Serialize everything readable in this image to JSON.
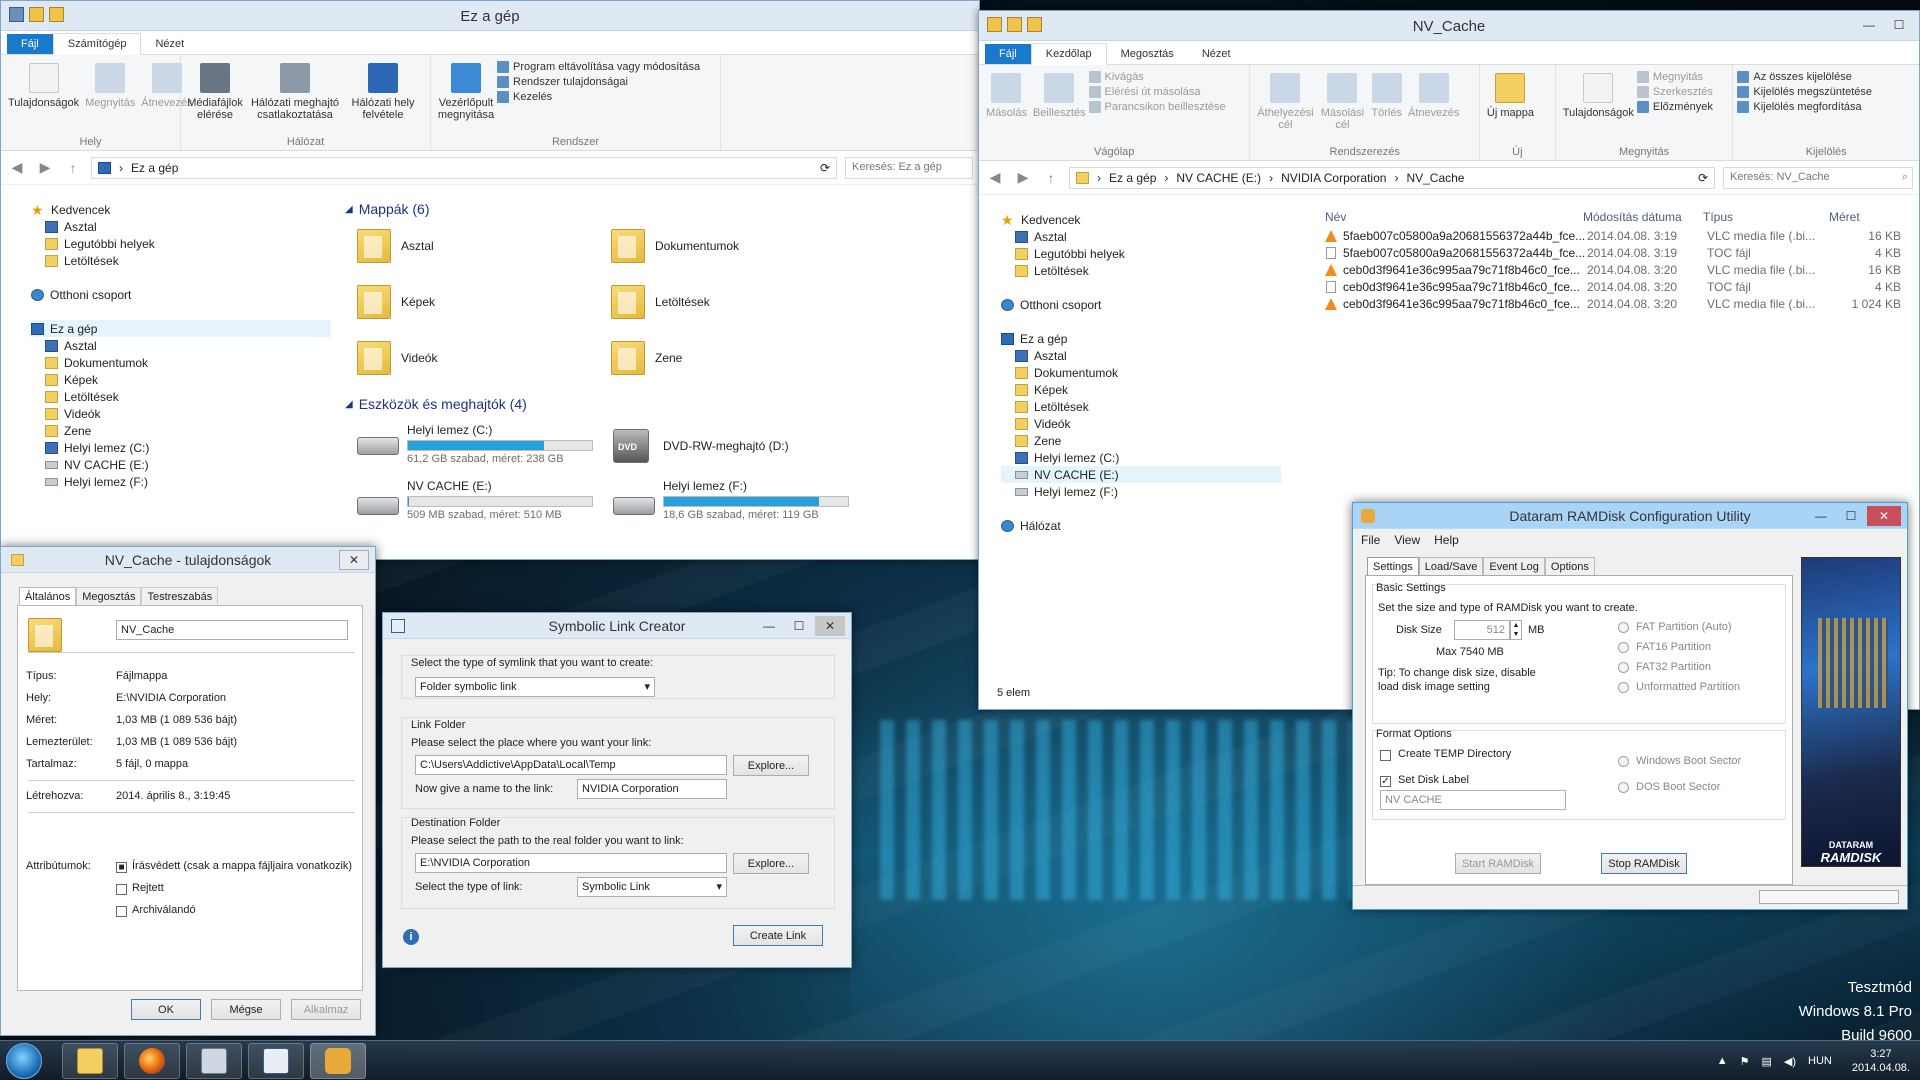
{
  "explorer1": {
    "title": "Ez a gép",
    "tabs": [
      "Fájl",
      "Számítógép",
      "Nézet"
    ],
    "ribbon": {
      "hely_group": "Hely",
      "halozat_group": "Hálózat",
      "rendszer_group": "Rendszer",
      "btn_tulajdonsagok": "Tulajdonságok",
      "btn_megnyitas": "Megnyitás",
      "btn_atnevezes": "Átnevezés",
      "btn_media": "Médiafájlok elérése",
      "btn_halozati_meghajto": "Hálózati meghajtó csatlakoztatása",
      "btn_halozati_hely": "Hálózati hely felvétele",
      "btn_vezerlopult": "Vezérlőpult megnyitása",
      "small_program": "Program eltávolítása vagy módosítása",
      "small_rendszer": "Rendszer tulajdonságai",
      "small_kezeles": "Kezelés"
    },
    "address": [
      "Ez a gép"
    ],
    "search_placeholder": "Keresés: Ez a gép",
    "nav": {
      "kedvencek": "Kedvencek",
      "asztal": "Asztal",
      "legutobbi": "Legutóbbi helyek",
      "letoltesek": "Letöltések",
      "otthoni": "Otthoni csoport",
      "ezagep": "Ez a gép",
      "asztal2": "Asztal",
      "dokumentumok": "Dokumentumok",
      "kepek": "Képek",
      "letoltesek2": "Letöltések",
      "videok": "Videók",
      "zene": "Zene",
      "helyi_c": "Helyi lemez (C:)",
      "nv_e": "NV CACHE (E:)",
      "helyi_f": "Helyi lemez (F:)"
    },
    "folders_header": "Mappák (6)",
    "folders": [
      "Asztal",
      "Dokumentumok",
      "Képek",
      "Letöltések",
      "Videók",
      "Zene"
    ],
    "drives_header": "Eszközök és meghajtók (4)",
    "drives": {
      "c": {
        "name": "Helyi lemez (C:)",
        "meta": "61,2 GB szabad, méret: 238 GB",
        "used_fraction": 0.74
      },
      "d": {
        "name": "DVD-RW-meghajtó (D:)"
      },
      "e": {
        "name": "NV CACHE (E:)",
        "meta": "509 MB szabad, méret: 510 MB",
        "used_fraction": 0.002
      },
      "f": {
        "name": "Helyi lemez (F:)",
        "meta": "18,6 GB szabad, méret: 119 GB",
        "used_fraction": 0.84
      }
    },
    "dvd_label": "DVD"
  },
  "explorer2": {
    "title": "NV_Cache",
    "tabs": [
      "Fájl",
      "Kezdőlap",
      "Megosztás",
      "Nézet"
    ],
    "ribbon": {
      "btn_masolas": "Másolás",
      "btn_beillesztes": "Beillesztés",
      "small_kivagas": "Kivágás",
      "small_eleresi": "Elérési út másolása",
      "small_parancsikon": "Parancsikon beillesztése",
      "vagolap_group": "Vágólap",
      "btn_athelyezes": "Áthelyezési cél",
      "btn_masolasi": "Másolási cél",
      "btn_torles": "Törlés",
      "btn_atnevezes": "Átnevezés",
      "rendszerezes_group": "Rendszerezés",
      "btn_uj_mappa": "Új mappa",
      "uj_group": "Új",
      "btn_tulajdonsagok": "Tulajdonságok",
      "small_megnyitas": "Megnyitás",
      "small_szerkesztes": "Szerkesztés",
      "small_elozmenyek": "Előzmények",
      "megnyitas_group": "Megnyitás",
      "small_osszes": "Az összes kijelölése",
      "small_megszuntetese": "Kijelölés megszüntetése",
      "small_megforditasa": "Kijelölés megfordítása",
      "kijeloles_group": "Kijelölés"
    },
    "address": [
      "Ez a gép",
      "NV CACHE (E:)",
      "NVIDIA Corporation",
      "NV_Cache"
    ],
    "search_placeholder": "Keresés: NV_Cache",
    "nav": {
      "kedvencek": "Kedvencek",
      "asztal": "Asztal",
      "legutobbi": "Legutóbbi helyek",
      "letoltesek": "Letöltések",
      "otthoni": "Otthoni csoport",
      "ezagep": "Ez a gép",
      "asztal2": "Asztal",
      "dokumentumok": "Dokumentumok",
      "kepek": "Képek",
      "letoltesek2": "Letöltések",
      "videok": "Videók",
      "zene": "Zene",
      "helyi_c": "Helyi lemez (C:)",
      "nv_e": "NV CACHE (E:)",
      "helyi_f": "Helyi lemez (F:)",
      "halozat": "Hálózat"
    },
    "columns": {
      "nev": "Név",
      "modositas": "Módosítás dátuma",
      "tipus": "Típus",
      "meret": "Méret"
    },
    "files": [
      {
        "name": "5faeb007c05800a9a20681556372a44b_fce...",
        "date": "2014.04.08. 3:19",
        "type": "VLC media file (.bi...",
        "size": "16 KB",
        "icon": "vlc"
      },
      {
        "name": "5faeb007c05800a9a20681556372a44b_fce...",
        "date": "2014.04.08. 3:19",
        "type": "TOC fájl",
        "size": "4 KB",
        "icon": "file"
      },
      {
        "name": "ceb0d3f9641e36c995aa79c71f8b46c0_fce...",
        "date": "2014.04.08. 3:20",
        "type": "VLC media file (.bi...",
        "size": "16 KB",
        "icon": "vlc"
      },
      {
        "name": "ceb0d3f9641e36c995aa79c71f8b46c0_fce...",
        "date": "2014.04.08. 3:20",
        "type": "TOC fájl",
        "size": "4 KB",
        "icon": "file"
      },
      {
        "name": "ceb0d3f9641e36c995aa79c71f8b46c0_fce...",
        "date": "2014.04.08. 3:20",
        "type": "VLC media file (.bi...",
        "size": "1 024 KB",
        "icon": "vlc"
      }
    ],
    "status": "5 elem"
  },
  "props": {
    "title": "NV_Cache - tulajdonságok",
    "tabs": [
      "Általános",
      "Megosztás",
      "Testreszabás"
    ],
    "name_value": "NV_Cache",
    "rows": [
      {
        "label": "Típus:",
        "value": "Fájlmappa"
      },
      {
        "label": "Hely:",
        "value": "E:\\NVIDIA Corporation"
      },
      {
        "label": "Méret:",
        "value": "1,03 MB (1 089 536 bájt)"
      },
      {
        "label": "Lemezterület:",
        "value": "1,03 MB (1 089 536 bájt)"
      },
      {
        "label": "Tartalmaz:",
        "value": "5 fájl, 0 mappa"
      },
      {
        "label": "Létrehozva:",
        "value": "2014. április 8., 3:19:45"
      }
    ],
    "attr_label": "Attribútumok:",
    "attr_readonly": "Írásvédett (csak a mappa fájljaira vonatkozik)",
    "attr_hidden": "Rejtett",
    "attr_archive": "Archiválandó",
    "btn_ok": "OK",
    "btn_cancel": "Mégse",
    "btn_apply": "Alkalmaz"
  },
  "symlink": {
    "title": "Symbolic Link Creator",
    "type_prompt": "Select the type of symlink that you want to create:",
    "type_value": "Folder symbolic link",
    "link_group": "Link Folder",
    "link_prompt": "Please select the place where you want your link:",
    "link_path": "C:\\Users\\Addictive\\AppData\\Local\\Temp",
    "explore": "Explore...",
    "name_prompt": "Now give a name to the link:",
    "name_value": "NVIDIA Corporation",
    "dest_group": "Destination Folder",
    "dest_prompt": "Please select the path to the real folder you want to link:",
    "dest_path": "E:\\NVIDIA Corporation",
    "linktype_prompt": "Select the type of link:",
    "linktype_value": "Symbolic Link",
    "create": "Create Link"
  },
  "ramdisk": {
    "title": "Dataram RAMDisk Configuration Utility",
    "menu": [
      "File",
      "View",
      "Help"
    ],
    "tabs": [
      "Settings",
      "Load/Save",
      "Event Log",
      "Options"
    ],
    "basic_group": "Basic Settings",
    "basic_desc": "Set the size and type of RAMDisk you want to create.",
    "disk_size_label": "Disk Size",
    "disk_size_value": "512",
    "unit": "MB",
    "max": "Max 7540 MB",
    "tip": "Tip: To change disk size, disable load disk image setting",
    "partitions": [
      "FAT Partition (Auto)",
      "FAT16 Partition",
      "FAT32 Partition",
      "Unformatted Partition"
    ],
    "format_group": "Format Options",
    "create_temp": "Create TEMP Directory",
    "set_label": "Set Disk Label",
    "label_value": "NV CACHE",
    "boot": [
      "Windows Boot Sector",
      "DOS Boot Sector"
    ],
    "start": "Start RAMDisk",
    "stop": "Stop RAMDisk",
    "logo_top": "DATARAM",
    "logo_bottom": "RAMDISK"
  },
  "watermark": {
    "line1": "Tesztmód",
    "line2": "Windows 8.1 Pro",
    "line3": "Build 9600"
  },
  "taskbar": {
    "lang": "HUN",
    "time": "3:27",
    "date": "2014.04.08."
  }
}
